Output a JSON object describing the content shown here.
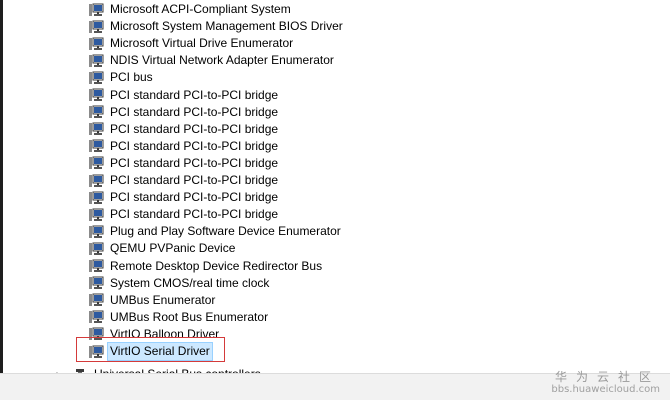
{
  "device_tree": {
    "devices": [
      {
        "label": "Microsoft ACPI-Compliant System",
        "icon": "system-device-icon"
      },
      {
        "label": "Microsoft System Management BIOS Driver",
        "icon": "system-device-icon"
      },
      {
        "label": "Microsoft Virtual Drive Enumerator",
        "icon": "system-device-icon"
      },
      {
        "label": "NDIS Virtual Network Adapter Enumerator",
        "icon": "system-device-icon"
      },
      {
        "label": "PCI bus",
        "icon": "system-device-icon"
      },
      {
        "label": "PCI standard PCI-to-PCI bridge",
        "icon": "system-device-icon"
      },
      {
        "label": "PCI standard PCI-to-PCI bridge",
        "icon": "system-device-icon"
      },
      {
        "label": "PCI standard PCI-to-PCI bridge",
        "icon": "system-device-icon"
      },
      {
        "label": "PCI standard PCI-to-PCI bridge",
        "icon": "system-device-icon"
      },
      {
        "label": "PCI standard PCI-to-PCI bridge",
        "icon": "system-device-icon"
      },
      {
        "label": "PCI standard PCI-to-PCI bridge",
        "icon": "system-device-icon"
      },
      {
        "label": "PCI standard PCI-to-PCI bridge",
        "icon": "system-device-icon"
      },
      {
        "label": "PCI standard PCI-to-PCI bridge",
        "icon": "system-device-icon"
      },
      {
        "label": "Plug and Play Software Device Enumerator",
        "icon": "system-device-icon"
      },
      {
        "label": "QEMU PVPanic Device",
        "icon": "system-device-icon"
      },
      {
        "label": "Remote Desktop Device Redirector Bus",
        "icon": "system-device-icon"
      },
      {
        "label": "System CMOS/real time clock",
        "icon": "system-device-icon"
      },
      {
        "label": "UMBus Enumerator",
        "icon": "system-device-icon"
      },
      {
        "label": "UMBus Root Bus Enumerator",
        "icon": "system-device-icon"
      },
      {
        "label": "VirtIO Balloon Driver",
        "icon": "system-device-icon"
      },
      {
        "label": "VirtIO Serial Driver",
        "icon": "system-device-icon",
        "selected": true
      }
    ],
    "next_category": {
      "label": "Universal Serial Bus controllers",
      "icon": "usb-controller-icon",
      "expander_glyph": "▷"
    }
  },
  "watermark": {
    "top_text": "华为云社区",
    "bottom_text": "bbs.huaweicloud.com"
  },
  "colors": {
    "highlight_border": "#d43a3a",
    "selection_fill": "#cce8ff",
    "icon_monitor": "#2d5aa0"
  }
}
